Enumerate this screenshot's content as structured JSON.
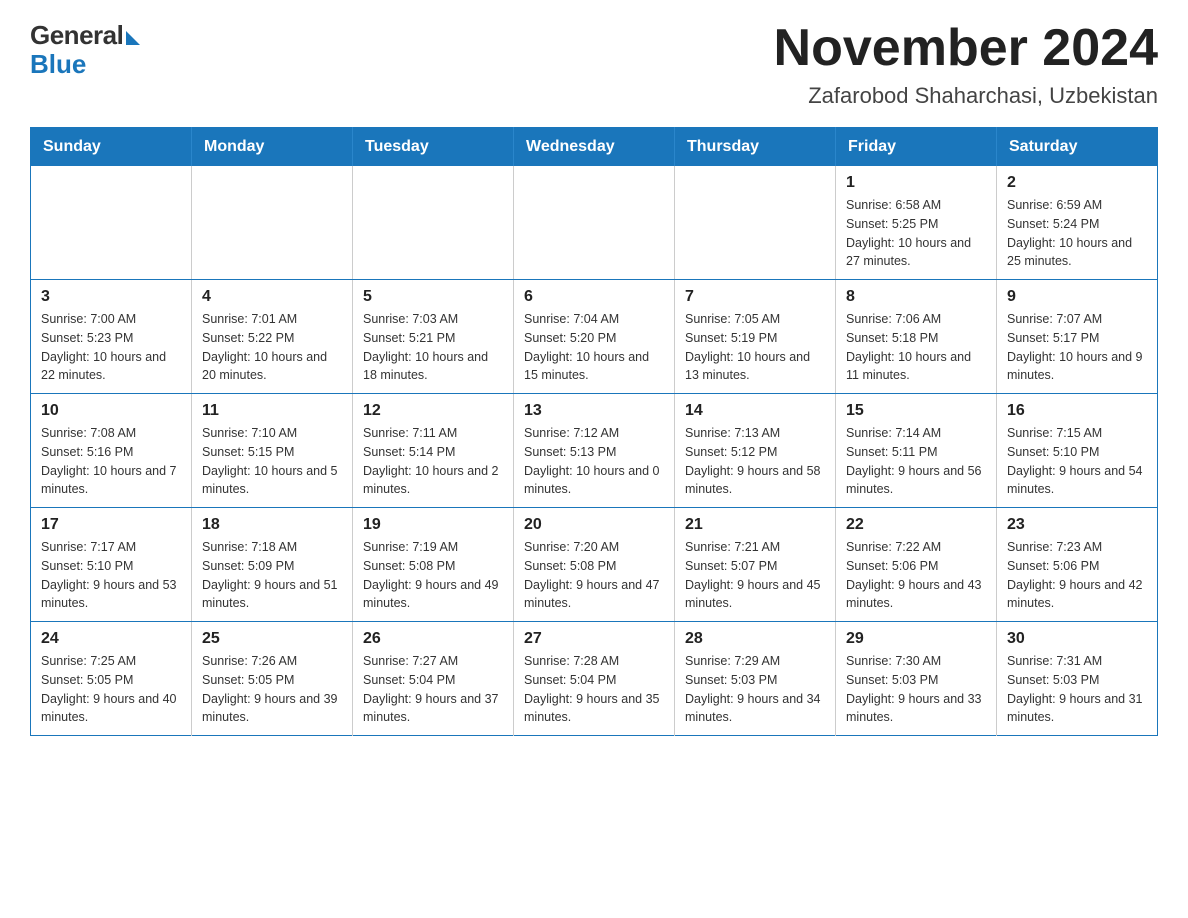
{
  "logo": {
    "general": "General",
    "blue": "Blue"
  },
  "header": {
    "month": "November 2024",
    "location": "Zafarobod Shaharchasi, Uzbekistan"
  },
  "weekdays": [
    "Sunday",
    "Monday",
    "Tuesday",
    "Wednesday",
    "Thursday",
    "Friday",
    "Saturday"
  ],
  "weeks": [
    [
      {
        "day": "",
        "sunrise": "",
        "sunset": "",
        "daylight": ""
      },
      {
        "day": "",
        "sunrise": "",
        "sunset": "",
        "daylight": ""
      },
      {
        "day": "",
        "sunrise": "",
        "sunset": "",
        "daylight": ""
      },
      {
        "day": "",
        "sunrise": "",
        "sunset": "",
        "daylight": ""
      },
      {
        "day": "",
        "sunrise": "",
        "sunset": "",
        "daylight": ""
      },
      {
        "day": "1",
        "sunrise": "Sunrise: 6:58 AM",
        "sunset": "Sunset: 5:25 PM",
        "daylight": "Daylight: 10 hours and 27 minutes."
      },
      {
        "day": "2",
        "sunrise": "Sunrise: 6:59 AM",
        "sunset": "Sunset: 5:24 PM",
        "daylight": "Daylight: 10 hours and 25 minutes."
      }
    ],
    [
      {
        "day": "3",
        "sunrise": "Sunrise: 7:00 AM",
        "sunset": "Sunset: 5:23 PM",
        "daylight": "Daylight: 10 hours and 22 minutes."
      },
      {
        "day": "4",
        "sunrise": "Sunrise: 7:01 AM",
        "sunset": "Sunset: 5:22 PM",
        "daylight": "Daylight: 10 hours and 20 minutes."
      },
      {
        "day": "5",
        "sunrise": "Sunrise: 7:03 AM",
        "sunset": "Sunset: 5:21 PM",
        "daylight": "Daylight: 10 hours and 18 minutes."
      },
      {
        "day": "6",
        "sunrise": "Sunrise: 7:04 AM",
        "sunset": "Sunset: 5:20 PM",
        "daylight": "Daylight: 10 hours and 15 minutes."
      },
      {
        "day": "7",
        "sunrise": "Sunrise: 7:05 AM",
        "sunset": "Sunset: 5:19 PM",
        "daylight": "Daylight: 10 hours and 13 minutes."
      },
      {
        "day": "8",
        "sunrise": "Sunrise: 7:06 AM",
        "sunset": "Sunset: 5:18 PM",
        "daylight": "Daylight: 10 hours and 11 minutes."
      },
      {
        "day": "9",
        "sunrise": "Sunrise: 7:07 AM",
        "sunset": "Sunset: 5:17 PM",
        "daylight": "Daylight: 10 hours and 9 minutes."
      }
    ],
    [
      {
        "day": "10",
        "sunrise": "Sunrise: 7:08 AM",
        "sunset": "Sunset: 5:16 PM",
        "daylight": "Daylight: 10 hours and 7 minutes."
      },
      {
        "day": "11",
        "sunrise": "Sunrise: 7:10 AM",
        "sunset": "Sunset: 5:15 PM",
        "daylight": "Daylight: 10 hours and 5 minutes."
      },
      {
        "day": "12",
        "sunrise": "Sunrise: 7:11 AM",
        "sunset": "Sunset: 5:14 PM",
        "daylight": "Daylight: 10 hours and 2 minutes."
      },
      {
        "day": "13",
        "sunrise": "Sunrise: 7:12 AM",
        "sunset": "Sunset: 5:13 PM",
        "daylight": "Daylight: 10 hours and 0 minutes."
      },
      {
        "day": "14",
        "sunrise": "Sunrise: 7:13 AM",
        "sunset": "Sunset: 5:12 PM",
        "daylight": "Daylight: 9 hours and 58 minutes."
      },
      {
        "day": "15",
        "sunrise": "Sunrise: 7:14 AM",
        "sunset": "Sunset: 5:11 PM",
        "daylight": "Daylight: 9 hours and 56 minutes."
      },
      {
        "day": "16",
        "sunrise": "Sunrise: 7:15 AM",
        "sunset": "Sunset: 5:10 PM",
        "daylight": "Daylight: 9 hours and 54 minutes."
      }
    ],
    [
      {
        "day": "17",
        "sunrise": "Sunrise: 7:17 AM",
        "sunset": "Sunset: 5:10 PM",
        "daylight": "Daylight: 9 hours and 53 minutes."
      },
      {
        "day": "18",
        "sunrise": "Sunrise: 7:18 AM",
        "sunset": "Sunset: 5:09 PM",
        "daylight": "Daylight: 9 hours and 51 minutes."
      },
      {
        "day": "19",
        "sunrise": "Sunrise: 7:19 AM",
        "sunset": "Sunset: 5:08 PM",
        "daylight": "Daylight: 9 hours and 49 minutes."
      },
      {
        "day": "20",
        "sunrise": "Sunrise: 7:20 AM",
        "sunset": "Sunset: 5:08 PM",
        "daylight": "Daylight: 9 hours and 47 minutes."
      },
      {
        "day": "21",
        "sunrise": "Sunrise: 7:21 AM",
        "sunset": "Sunset: 5:07 PM",
        "daylight": "Daylight: 9 hours and 45 minutes."
      },
      {
        "day": "22",
        "sunrise": "Sunrise: 7:22 AM",
        "sunset": "Sunset: 5:06 PM",
        "daylight": "Daylight: 9 hours and 43 minutes."
      },
      {
        "day": "23",
        "sunrise": "Sunrise: 7:23 AM",
        "sunset": "Sunset: 5:06 PM",
        "daylight": "Daylight: 9 hours and 42 minutes."
      }
    ],
    [
      {
        "day": "24",
        "sunrise": "Sunrise: 7:25 AM",
        "sunset": "Sunset: 5:05 PM",
        "daylight": "Daylight: 9 hours and 40 minutes."
      },
      {
        "day": "25",
        "sunrise": "Sunrise: 7:26 AM",
        "sunset": "Sunset: 5:05 PM",
        "daylight": "Daylight: 9 hours and 39 minutes."
      },
      {
        "day": "26",
        "sunrise": "Sunrise: 7:27 AM",
        "sunset": "Sunset: 5:04 PM",
        "daylight": "Daylight: 9 hours and 37 minutes."
      },
      {
        "day": "27",
        "sunrise": "Sunrise: 7:28 AM",
        "sunset": "Sunset: 5:04 PM",
        "daylight": "Daylight: 9 hours and 35 minutes."
      },
      {
        "day": "28",
        "sunrise": "Sunrise: 7:29 AM",
        "sunset": "Sunset: 5:03 PM",
        "daylight": "Daylight: 9 hours and 34 minutes."
      },
      {
        "day": "29",
        "sunrise": "Sunrise: 7:30 AM",
        "sunset": "Sunset: 5:03 PM",
        "daylight": "Daylight: 9 hours and 33 minutes."
      },
      {
        "day": "30",
        "sunrise": "Sunrise: 7:31 AM",
        "sunset": "Sunset: 5:03 PM",
        "daylight": "Daylight: 9 hours and 31 minutes."
      }
    ]
  ]
}
